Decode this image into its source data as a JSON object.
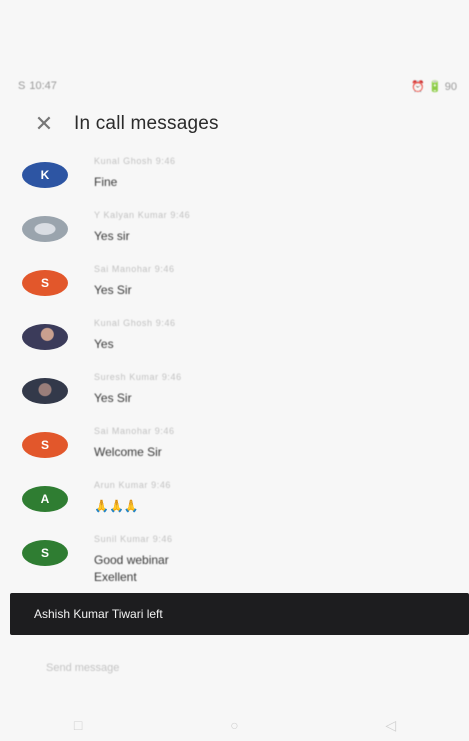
{
  "status_bar": {
    "time": "10:47",
    "left_prefix": "S",
    "right_text": "⏰ 🔋 90"
  },
  "header": {
    "close_icon_glyph": "✕",
    "title": "In call messages"
  },
  "messages": [
    {
      "avatar_letter": "K",
      "avatar_color": "#2d55a3",
      "meta": "Kunal Ghosh  9:46",
      "text": "Fine"
    },
    {
      "avatar_letter": "",
      "avatar_color": "",
      "meta": "Y Kalyan Kumar  9:46",
      "text": "Yes sir"
    },
    {
      "avatar_letter": "S",
      "avatar_color": "#e2572b",
      "meta": "Sai Manohar  9:46",
      "text": "Yes Sir"
    },
    {
      "avatar_letter": "",
      "avatar_color": "",
      "meta": "Kunal Ghosh  9:46",
      "text": "Yes"
    },
    {
      "avatar_letter": "",
      "avatar_color": "",
      "meta": "Suresh Kumar  9:46",
      "text": "Yes Sir"
    },
    {
      "avatar_letter": "S",
      "avatar_color": "#e2572b",
      "meta": "Sai Manohar  9:46",
      "text": "Welcome Sir"
    },
    {
      "avatar_letter": "A",
      "avatar_color": "#2f7d32",
      "meta": "Arun Kumar  9:46",
      "text": "🙏🙏🙏"
    },
    {
      "avatar_letter": "S",
      "avatar_color": "#2f7d32",
      "meta": "Sunil Kumar  9:46",
      "text": "Good webinar",
      "text2": "Exellent"
    }
  ],
  "toast": {
    "text": "Ashish Kumar Tiwari left"
  },
  "composer": {
    "placeholder": "Send message"
  },
  "navbar": {
    "back": "◁",
    "home": "○",
    "recent": "□"
  }
}
